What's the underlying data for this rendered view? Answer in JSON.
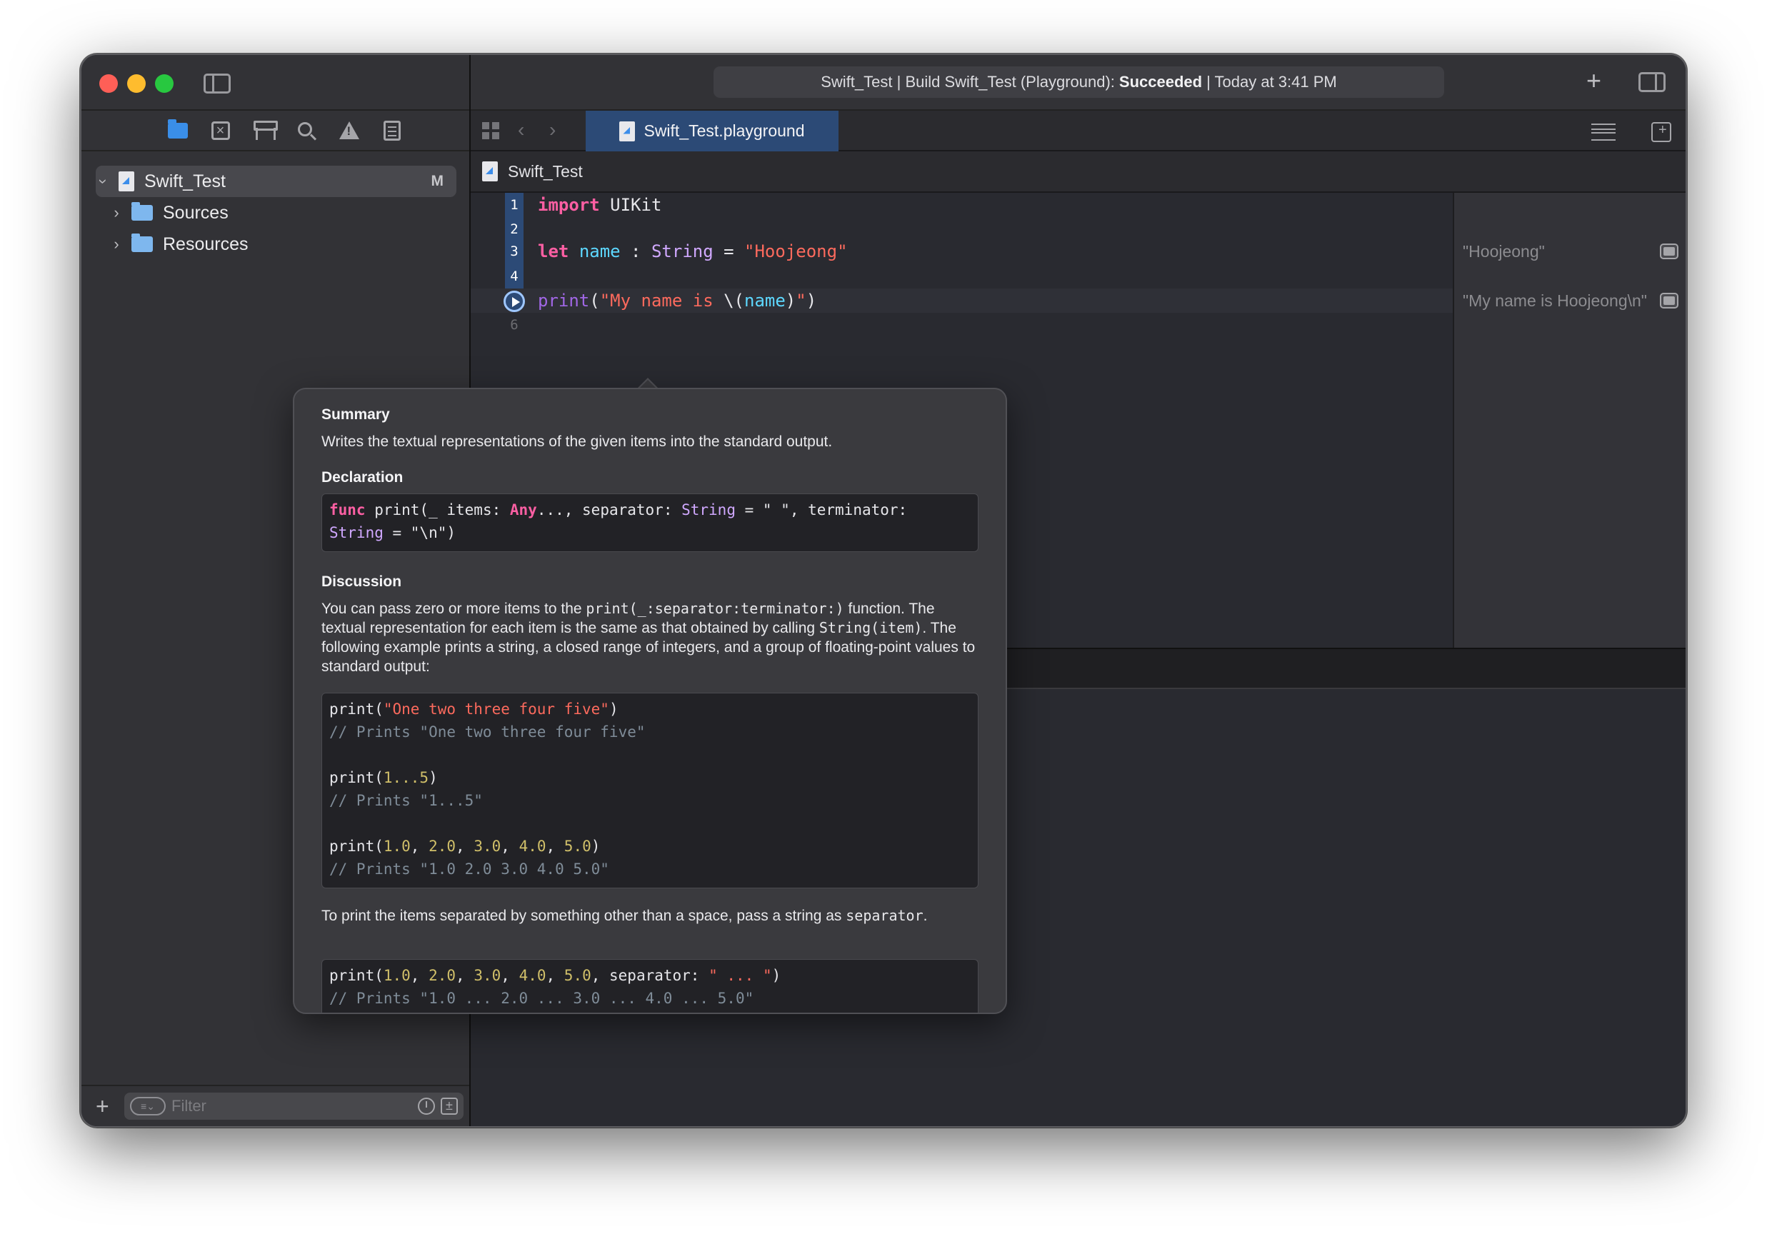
{
  "window": {
    "activity_prefix": "Swift_Test | Build Swift_Test (Playground):",
    "activity_status": "Succeeded",
    "activity_suffix": "| Today at 3:41 PM"
  },
  "sidebar": {
    "project": {
      "name": "Swift_Test",
      "badge": "M"
    },
    "items": [
      {
        "label": "Sources"
      },
      {
        "label": "Resources"
      }
    ],
    "filter_placeholder": "Filter"
  },
  "tabbar": {
    "active_tab": "Swift_Test.playground"
  },
  "jumpbar": {
    "file": "Swift_Test"
  },
  "editor": {
    "line_numbers": [
      "1",
      "2",
      "3",
      "4",
      "",
      "6"
    ],
    "line1": {
      "kw": "import",
      "rest": " UIKit"
    },
    "line3": {
      "kw": "let",
      "id": "name",
      "sep": " : ",
      "type": "String",
      "eq": " = ",
      "str": "\"Hoojeong\""
    },
    "line5": {
      "fn": "print",
      "open": "(",
      "str1": "\"My name is ",
      "interp_open": "\\(",
      "id": "name",
      "interp_close": ")",
      "str2": "\"",
      "close": ")"
    }
  },
  "results": [
    "\"Hoojeong\"",
    "\"My name is Hoojeong\\n\""
  ],
  "quick_help": {
    "summary_heading": "Summary",
    "summary_text": "Writes the textual representations of the given items into the standard output.",
    "declaration_heading": "Declaration",
    "decl": {
      "func_kw": "func",
      "part1": " print(_ items: ",
      "any": "Any",
      "part2": "..., separator: ",
      "string1": "String",
      "part3": " = \" \", terminator:",
      "string2": "String",
      "part4": " = \"\\n\")"
    },
    "discussion_heading": "Discussion",
    "discussion": {
      "t1": "You can pass zero or more items to the ",
      "c1": "print(_:separator:terminator:)",
      "t2": "function. The textual representation for each item is the same as that obtained by calling ",
      "c2": "String(item)",
      "t3": ". The following example prints a string, a closed range of integers, and a group of floating-point values to standard output:"
    },
    "example1": {
      "l1_fn": "print(",
      "l1_str": "\"One two three four five\"",
      "l1_close": ")",
      "l2": "// Prints \"One two three four five\"",
      "l4_fn": "print(",
      "l4_num": "1...5",
      "l4_close": ")",
      "l5": "// Prints \"1...5\"",
      "l7_fn": "print(",
      "l7_n1": "1.0",
      "l7_n2": "2.0",
      "l7_n3": "3.0",
      "l7_n4": "4.0",
      "l7_n5": "5.0",
      "l7_close": ")",
      "l8": "// Prints \"1.0 2.0 3.0 4.0 5.0\""
    },
    "separator_text_1": "To print the items separated by something other than a space, pass a string as",
    "separator_code": "separator",
    "separator_text_2": ".",
    "example2": {
      "fn": "print(",
      "n1": "1.0",
      "n2": "2.0",
      "n3": "3.0",
      "n4": "4.0",
      "n5": "5.0",
      "sep_label": ", separator: ",
      "sep_str": "\" ... \"",
      "close": ")",
      "comment": "// Prints \"1.0 ... 2.0 ... 3.0 ... 4.0 ... 5.0\""
    }
  }
}
